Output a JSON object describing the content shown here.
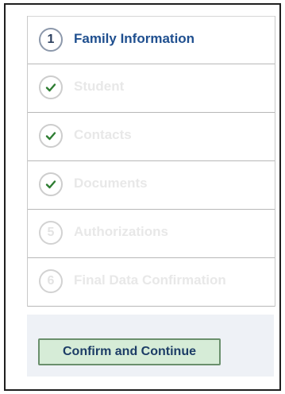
{
  "steps": [
    {
      "number": "1",
      "label": "Family Information",
      "state": "active"
    },
    {
      "number": "",
      "label": "Student",
      "state": "complete"
    },
    {
      "number": "",
      "label": "Contacts",
      "state": "complete"
    },
    {
      "number": "",
      "label": "Documents",
      "state": "complete"
    },
    {
      "number": "5",
      "label": "Authorizations",
      "state": "pending"
    },
    {
      "number": "6",
      "label": "Final Data Confirmation",
      "state": "pending"
    }
  ],
  "footer": {
    "confirm_label": "Confirm and Continue"
  },
  "colors": {
    "active_text": "#1f4f8f",
    "check": "#2e7d32",
    "button_bg": "#d6ecd7",
    "button_border": "#6a8f6c",
    "footer_bg": "#eef1f6"
  }
}
